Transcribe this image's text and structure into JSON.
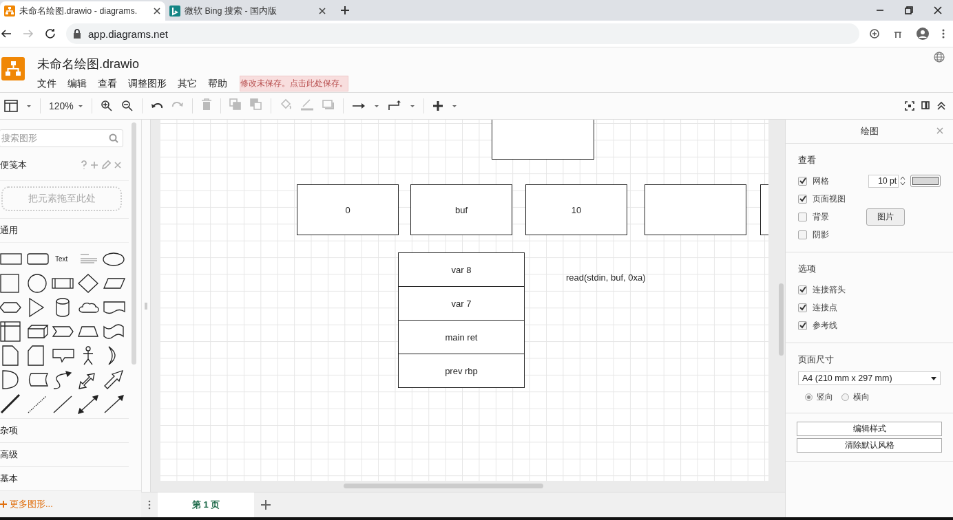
{
  "browser": {
    "tabs": [
      {
        "title": "未命名绘图.drawio - diagrams.",
        "selected": true,
        "kind": "drawio"
      },
      {
        "title": "微软 Bing 搜索 - 国内版",
        "selected": false,
        "kind": "bing"
      }
    ],
    "url": "app.diagrams.net"
  },
  "app": {
    "title": "未命名绘图.drawio",
    "menu": [
      "文件",
      "编辑",
      "查看",
      "调整图形",
      "其它",
      "帮助"
    ],
    "save_notice": "修改未保存。点击此处保存。"
  },
  "toolbar": {
    "zoom": "120%"
  },
  "sidebar": {
    "search": {
      "placeholder": "搜索图形"
    },
    "scratchpad": {
      "title": "便笺本",
      "hint": "把元素拖至此处"
    },
    "sections": [
      {
        "title": "通用"
      },
      {
        "title": "杂项"
      },
      {
        "title": "高级"
      },
      {
        "title": "基本"
      }
    ],
    "text_shape": "Text",
    "more_shapes": "更多图形..."
  },
  "canvas": {
    "nodes": [
      {
        "kind": "box"
      },
      {
        "kind": "box",
        "label": "0"
      },
      {
        "kind": "box",
        "label": "buf"
      },
      {
        "kind": "box",
        "label": "10"
      },
      {
        "kind": "box"
      },
      {
        "kind": "box"
      },
      {
        "kind": "box",
        "label": "var 8"
      },
      {
        "kind": "box",
        "label": "var 7"
      },
      {
        "kind": "box",
        "label": "main ret"
      },
      {
        "kind": "box",
        "label": "prev rbp"
      },
      {
        "kind": "text",
        "label": "read(stdin, buf, 0xa)"
      }
    ]
  },
  "pages": [
    {
      "label": "第 1 页",
      "selected": true
    }
  ],
  "format_panel": {
    "title": "绘图",
    "view": {
      "title": "查看",
      "options": [
        {
          "label": "网格",
          "checked": true
        },
        {
          "label": "页面视图",
          "checked": true
        },
        {
          "label": "背景",
          "checked": false
        },
        {
          "label": "阴影",
          "checked": false
        }
      ],
      "grid_size": "10 pt",
      "image_button": "图片"
    },
    "options": {
      "title": "选项",
      "items": [
        {
          "label": "连接箭头",
          "checked": true
        },
        {
          "label": "连接点",
          "checked": true
        },
        {
          "label": "参考线",
          "checked": true
        }
      ]
    },
    "page_size": {
      "title": "页面尺寸",
      "value": "A4 (210 mm x 297 mm)",
      "orientations": [
        {
          "label": "竖向",
          "selected": true
        },
        {
          "label": "横向",
          "selected": false
        }
      ]
    },
    "buttons": [
      "编辑样式",
      "清除默认风格"
    ]
  }
}
